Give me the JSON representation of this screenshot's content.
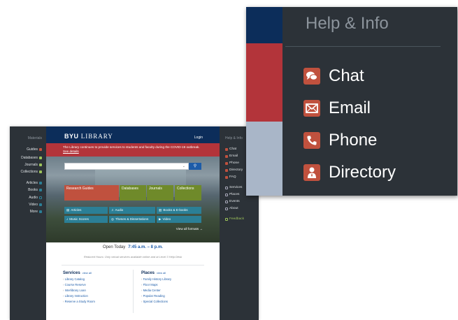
{
  "left_nav": {
    "heading": "Materials",
    "items": [
      {
        "label": "Guides"
      },
      {
        "label": "Databases"
      },
      {
        "label": "Journals"
      },
      {
        "label": "Collections"
      },
      {
        "label": "Articles"
      },
      {
        "label": "Books"
      },
      {
        "label": "Audio"
      },
      {
        "label": "Video"
      },
      {
        "label": "More"
      }
    ]
  },
  "header": {
    "logo_byu": "BYU",
    "logo_library": "LIBRARY",
    "login": "Login"
  },
  "alert": {
    "text": "The Library continues to provide services to students and faculty during the COVID-19 outbreak.",
    "link": "See details"
  },
  "tiles": {
    "research_guides": "Research Guides",
    "databases": "Databases",
    "journals": "Journals",
    "collections": "Collections"
  },
  "formats": {
    "articles": "Articles",
    "audio": "Audio",
    "books": "Books & E-books",
    "music": "Music Scores",
    "theses": "Theses & Dissertations",
    "video": "Video",
    "view_all": "View all formats →"
  },
  "hours": {
    "label": "Open Today",
    "time": "7:45 a.m. – 8 p.m.",
    "note": "Reduced Hours: Only virtual services available online and at Level 3 Help Desk"
  },
  "services": {
    "heading": "Services",
    "view_all": "view all",
    "links": [
      "Library Catalog",
      "Course Reserve",
      "Interlibrary Loan",
      "Library Instruction",
      "Reserve a Study Room"
    ]
  },
  "places": {
    "heading": "Places",
    "view_all": "view all",
    "links": [
      "Family History Library",
      "Floor Maps",
      "Media Center",
      "Popular Reading",
      "Special Collections"
    ]
  },
  "right_nav": {
    "heading": "Help & Info",
    "items": [
      {
        "label": "Chat",
        "icon": "chat-icon"
      },
      {
        "label": "Email",
        "icon": "email-icon"
      },
      {
        "label": "Phone",
        "icon": "phone-icon"
      },
      {
        "label": "Directory",
        "icon": "directory-icon"
      },
      {
        "label": "FAQ",
        "icon": "faq-icon"
      },
      {
        "label": "Services",
        "icon": "services-icon"
      },
      {
        "label": "Places",
        "icon": "places-icon"
      },
      {
        "label": "Events",
        "icon": "events-icon"
      },
      {
        "label": "About",
        "icon": "about-icon"
      },
      {
        "label": "Feedback",
        "icon": "feedback-icon"
      }
    ]
  },
  "inset": {
    "heading": "Help & Info",
    "items": [
      {
        "label": "Chat",
        "icon": "chat-icon"
      },
      {
        "label": "Email",
        "icon": "email-icon"
      },
      {
        "label": "Phone",
        "icon": "phone-icon"
      },
      {
        "label": "Directory",
        "icon": "directory-icon"
      }
    ]
  },
  "colors": {
    "navy": "#0c2d5a",
    "alert_red": "#b3343a",
    "nav_dark": "#2c3238",
    "icon_red": "#c0513e",
    "tile_green": "#6f8a2a",
    "format_teal": "#2b7f96",
    "link_blue": "#1d5ca8"
  }
}
